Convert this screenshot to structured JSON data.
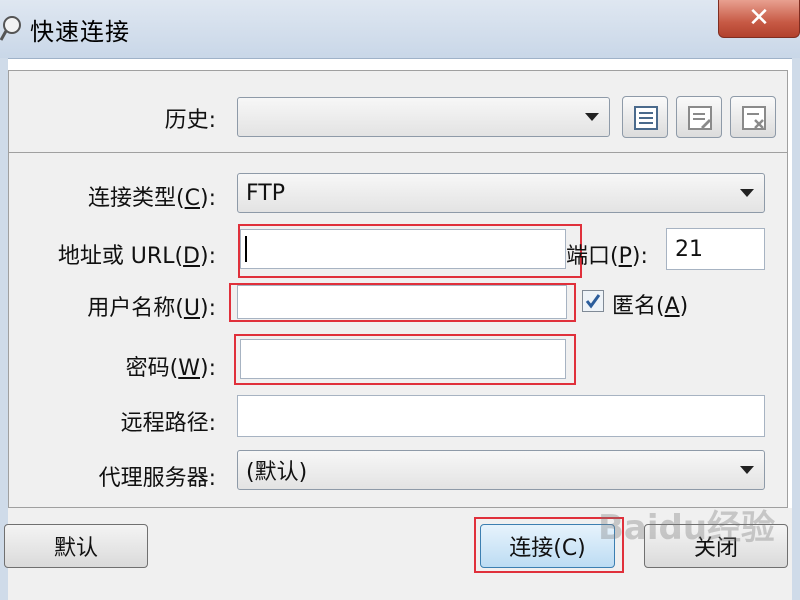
{
  "window": {
    "title": "快速连接",
    "close_label": "✕"
  },
  "history": {
    "label": "历史:",
    "value": "",
    "buttons": [
      "history-manage-icon",
      "history-edit-icon",
      "history-delete-icon"
    ]
  },
  "form": {
    "connection_type": {
      "label_prefix": "连接类型(",
      "accel": "C",
      "label_suffix": "):",
      "value": "FTP"
    },
    "address": {
      "label_prefix": "地址或 URL(",
      "accel": "D",
      "label_suffix": "):",
      "value": ""
    },
    "port": {
      "label_prefix": "端口(",
      "accel": "P",
      "label_suffix": "):",
      "value": "21"
    },
    "username": {
      "label_prefix": "用户名称(",
      "accel": "U",
      "label_suffix": "):",
      "value": ""
    },
    "anonymous": {
      "label_prefix": "匿名(",
      "accel": "A",
      "label_suffix": ")",
      "checked": true
    },
    "password": {
      "label_prefix": "密码(",
      "accel": "W",
      "label_suffix": "):",
      "value": ""
    },
    "remote_path": {
      "label": "远程路径:",
      "value": ""
    },
    "proxy": {
      "label": "代理服务器:",
      "value": "(默认)"
    }
  },
  "buttons": {
    "default_label": "默认",
    "connect_label": "连接(C)",
    "close_label": "关闭"
  },
  "watermark": {
    "text": "Baidu经验"
  },
  "colors": {
    "highlight": "#e0303b",
    "title_bar": "#c9d7e8"
  }
}
